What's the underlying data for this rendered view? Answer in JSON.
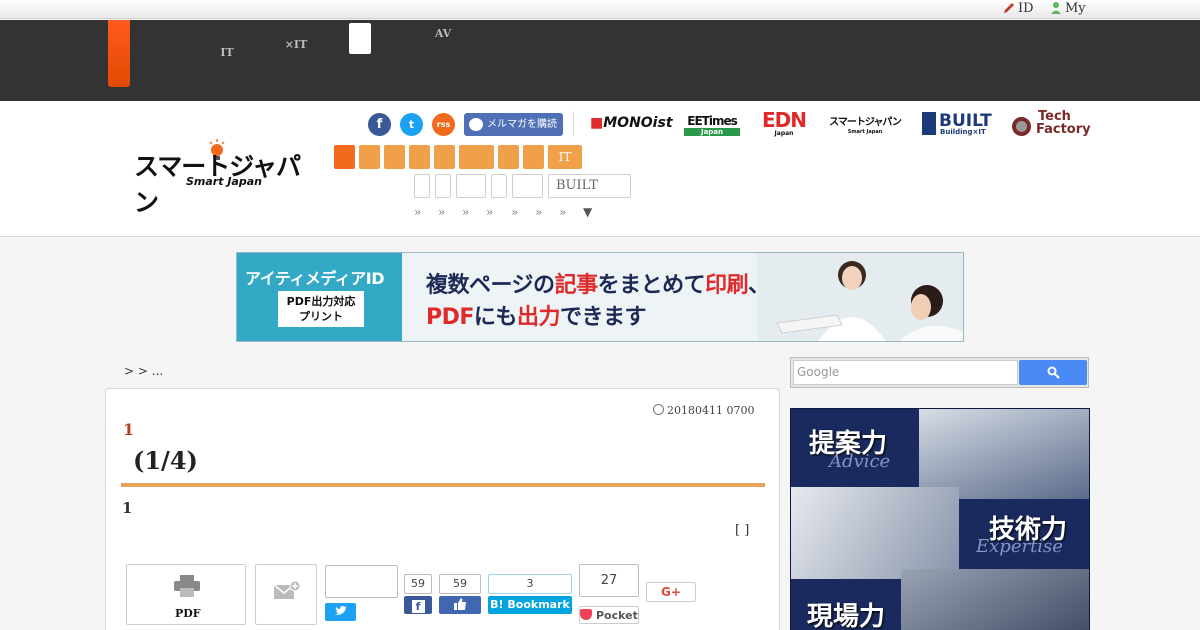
{
  "util_bar": {
    "id_label": "ID",
    "my_label": "My"
  },
  "dark_nav": {
    "items": [
      {
        "line1": "",
        "line2": "IT"
      },
      {
        "line1": "",
        "line2": "×IT"
      },
      {
        "line1": "AV",
        "line2": ""
      }
    ]
  },
  "header": {
    "logo": {
      "jp": "スマートジャパン",
      "en": "Smart Japan"
    },
    "social": {
      "facebook_glyph": "f",
      "twitter_glyph": "t",
      "rss_glyph": "rss"
    },
    "mailmag_label": "メルマガを購読",
    "brands": {
      "mono": "MONOist",
      "eetimes": "EETimes",
      "eetimes_sub": "Japan",
      "edn": "EDN",
      "edn_sub": "Japan",
      "smartjapan": "スマートジャパン",
      "smartjapan_sub": "Smart Japan",
      "built": "BUILT",
      "built_sub": "Building×IT",
      "tech": "Tech",
      "factory": "Factory"
    },
    "categories": [
      "",
      "",
      "",
      "",
      "",
      "",
      "",
      "",
      "IT"
    ],
    "sub_categories": [
      "",
      "",
      "",
      "",
      "",
      "BUILT"
    ],
    "raquo_items": [
      "»",
      "»",
      "»",
      "»",
      "»",
      "»",
      "»",
      "▼"
    ]
  },
  "banner": {
    "title": "アイティメディアID",
    "badge_line1": "PDF出力対応",
    "badge_line2": "プリント",
    "line1_a": "複数ページの",
    "line1_b": "記事",
    "line1_c": "をまとめて",
    "line1_d": "印刷",
    "line1_e": "、",
    "line2_a": "PDF",
    "line2_b": "にも",
    "line2_c": "出力",
    "line2_d": "できます"
  },
  "breadcrumb": "> > ...",
  "article": {
    "date": "20180411 0700",
    "kicker": "1",
    "title": "(1/4)",
    "lead": "1",
    "bracket": "[ ]",
    "share": {
      "pdf_label": "PDF",
      "fb_count": "59",
      "like_count": "59",
      "hatena_count": "3",
      "hatena_label": "Bookmark",
      "pocket_count": "27",
      "pocket_label": "Pocket",
      "gplus_label": "G+"
    }
  },
  "sidebar": {
    "search_placeholder": "Google",
    "ad": {
      "word1": "提案力",
      "sub1": "Advice",
      "word2": "技術力",
      "sub2": "Expertise",
      "word3": "現場力"
    }
  },
  "colors": {
    "nav_dark": "#333333",
    "accent_orange": "#f0a048",
    "accent_orange_active": "#f26b1c",
    "rule": "#e5a35a",
    "kicker": "#b2441a",
    "facebook": "#3b5998",
    "twitter": "#1da1f2",
    "hatena": "#00a4de",
    "pocket": "#ef4056"
  }
}
